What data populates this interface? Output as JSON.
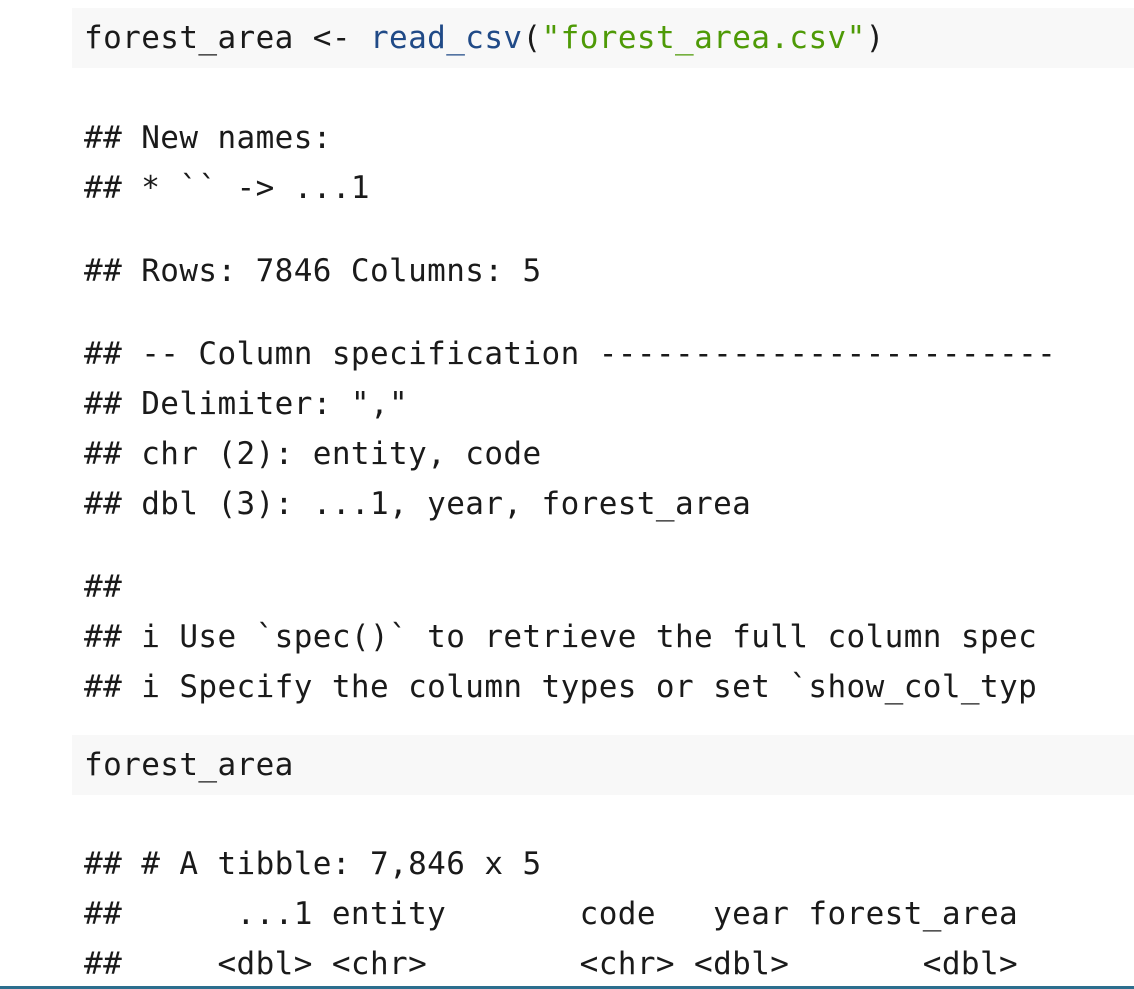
{
  "chunk1": {
    "var": "forest_area",
    "assign": " <- ",
    "fn": "read_csv",
    "open": "(",
    "arg": "\"forest_area.csv\"",
    "close": ")"
  },
  "output1": [
    "## New names:",
    "## * `` -> ...1",
    "## Rows: 7846 Columns: 5",
    "## -- Column specification ------------------------",
    "## Delimiter: \",\"",
    "## chr (2): entity, code",
    "## dbl (3): ...1, year, forest_area",
    "##",
    "## i Use `spec()` to retrieve the full column spec",
    "## i Specify the column types or set `show_col_typ"
  ],
  "chunk2": {
    "code": "forest_area"
  },
  "output2": [
    "## # A tibble: 7,846 x 5",
    "##      ...1 entity       code   year forest_area",
    "##     <dbl> <chr>        <chr> <dbl>       <dbl>"
  ],
  "colors": {
    "code_background": "#f8f8f8",
    "function": "#204a87",
    "string": "#4e9a06",
    "text": "#1a1a1a",
    "bottom_bar": "#2c6e8e"
  }
}
